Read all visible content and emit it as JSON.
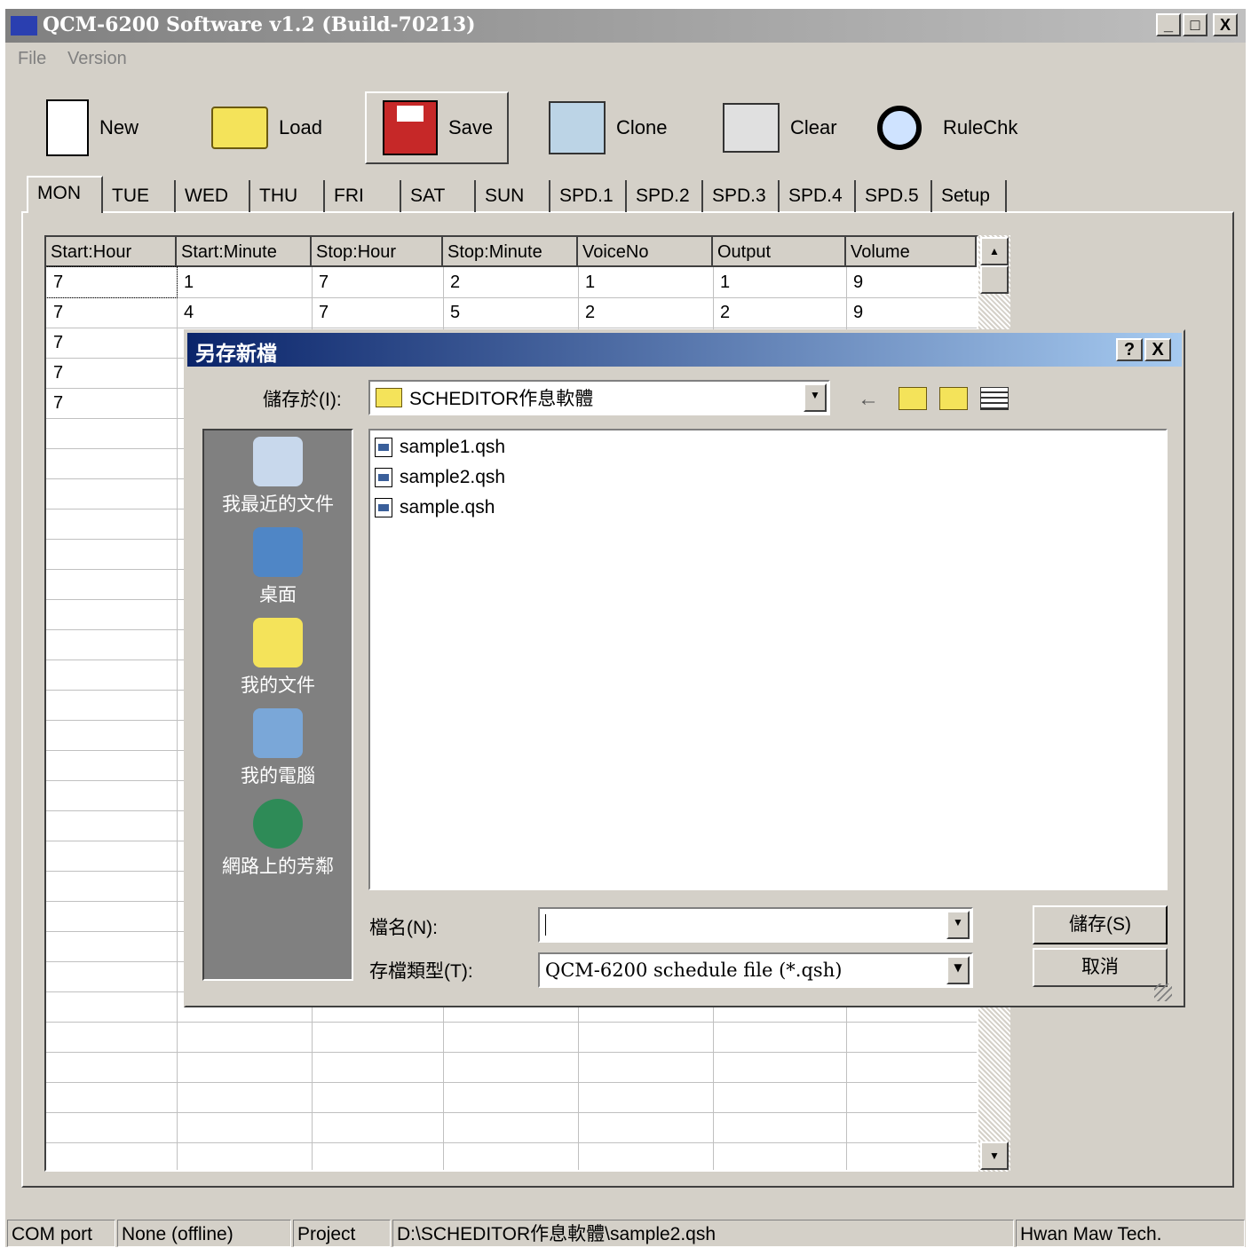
{
  "window": {
    "title": "QCM-6200 Software v1.2 (Build-70213)",
    "controls": [
      "_",
      "□",
      "X"
    ]
  },
  "menu": [
    "File",
    "Version"
  ],
  "toolbar": [
    {
      "label": "New",
      "icon": "new-file-icon"
    },
    {
      "label": "Load",
      "icon": "folder-icon"
    },
    {
      "label": "Save",
      "icon": "floppy-disk-icon"
    },
    {
      "label": "Clone",
      "icon": "clone-icon"
    },
    {
      "label": "Clear",
      "icon": "shredder-icon"
    },
    {
      "label": "RuleChk",
      "icon": "magnifier-hex-icon"
    }
  ],
  "tabs": [
    "MON",
    "TUE",
    "WED",
    "THU",
    "FRI",
    "SAT",
    "SUN",
    "SPD.1",
    "SPD.2",
    "SPD.3",
    "SPD.4",
    "SPD.5",
    "Setup"
  ],
  "active_tab": "MON",
  "grid": {
    "columns": [
      "Start:Hour",
      "Start:Minute",
      "Stop:Hour",
      "Stop:Minute",
      "VoiceNo",
      "Output",
      "Volume"
    ],
    "rows": [
      [
        "7",
        "1",
        "7",
        "2",
        "1",
        "1",
        "9"
      ],
      [
        "7",
        "4",
        "7",
        "5",
        "2",
        "2",
        "9"
      ],
      [
        "7",
        "",
        "",
        "",
        "",
        "",
        ""
      ],
      [
        "7",
        "",
        "",
        "",
        "",
        "",
        ""
      ],
      [
        "7",
        "",
        "",
        "",
        "",
        "",
        ""
      ]
    ]
  },
  "dialog": {
    "title": "另存新檔",
    "help": "?",
    "close": "X",
    "save_in_label": "儲存於(I):",
    "save_in_value": "SCHEDITOR作息軟體",
    "places": [
      "我最近的文件",
      "桌面",
      "我的文件",
      "我的電腦",
      "網路上的芳鄰"
    ],
    "files": [
      "sample1.qsh",
      "sample2.qsh",
      "sample.qsh"
    ],
    "filename_label": "檔名(N):",
    "filename_value": "",
    "filetype_label": "存檔類型(T):",
    "filetype_value": "QCM-6200 schedule file (*.qsh)",
    "save_button": "儲存(S)",
    "cancel_button": "取消"
  },
  "statusbar": {
    "com_label": "COM port",
    "com_value": "None (offline)",
    "project_label": "Project",
    "project_value": "D:\\SCHEDITOR作息軟體\\sample2.qsh",
    "vendor": "Hwan Maw Tech."
  }
}
